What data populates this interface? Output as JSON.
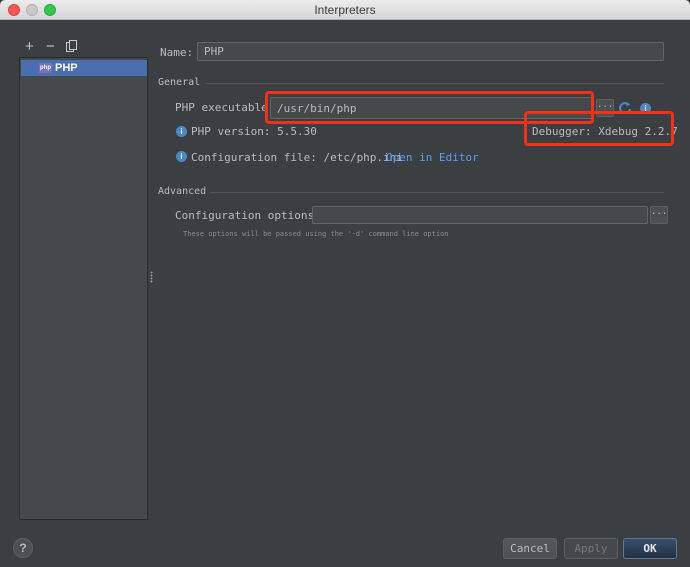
{
  "window": {
    "title": "Interpreters"
  },
  "toolbar": {
    "add": "+",
    "remove": "−"
  },
  "sidebar": {
    "items": [
      {
        "label": "PHP",
        "badge": "php"
      }
    ]
  },
  "form": {
    "name_label": "Name:",
    "name_value": "PHP",
    "general_title": "General",
    "executable_label": "PHP executable:",
    "executable_value": "/usr/bin/php",
    "browse_label": "...",
    "version_label": "PHP version: 5.5.30",
    "debugger_label": "Debugger: Xdebug 2.2.7",
    "config_label": "Configuration file: /etc/php.ini",
    "open_in_editor": "Open in Editor",
    "advanced_title": "Advanced",
    "options_label": "Configuration options:",
    "options_value": "",
    "options_hint": "These options will be passed using the '-d' command line option"
  },
  "footer": {
    "help": "?",
    "cancel": "Cancel",
    "apply": "Apply",
    "ok": "OK"
  },
  "colors": {
    "background": "#3c3f41",
    "selection": "#4b6eaf",
    "link": "#589df6",
    "highlight": "#f2311c",
    "info": "#4a88c7"
  },
  "icons": [
    "close-icon",
    "minimize-icon",
    "maximize-icon",
    "add-icon",
    "remove-icon",
    "copy-icon",
    "php-icon",
    "reload-icon",
    "info-icon",
    "help-icon"
  ]
}
